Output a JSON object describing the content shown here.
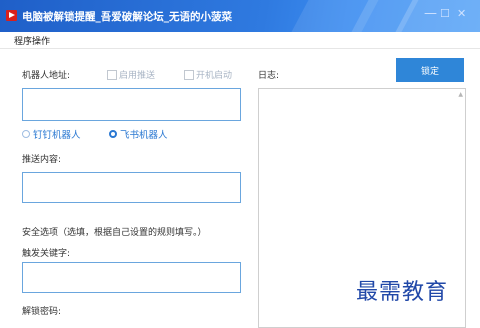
{
  "window": {
    "title": "电脑被解锁提醒_吾爱破解论坛_无语的小菠菜",
    "min_glyph": "—",
    "max_glyph": "☐",
    "close_glyph": "✕"
  },
  "menu": {
    "items": [
      "程序操作"
    ]
  },
  "form": {
    "robot_address_label": "机器人地址:",
    "enable_push_label": "启用推送",
    "autostart_label": "开机启动",
    "robot_address_value": "",
    "robot_types": [
      {
        "label": "钉钉机器人",
        "selected": false
      },
      {
        "label": "飞书机器人",
        "selected": true
      }
    ],
    "push_content_label": "推送内容:",
    "push_content_value": "",
    "security_note": "安全选项（选填，根据自己设置的规则填写。）",
    "trigger_keyword_label": "触发关键字:",
    "trigger_keyword_value": "",
    "unlock_password_label": "解锁密码:"
  },
  "log_panel": {
    "label": "日志:",
    "lock_button": "锁定"
  },
  "watermark": "最需教育",
  "colors": {
    "titlebar": "#2f7ae0",
    "accent": "#2f86d8",
    "input_border": "#6aa6de"
  }
}
